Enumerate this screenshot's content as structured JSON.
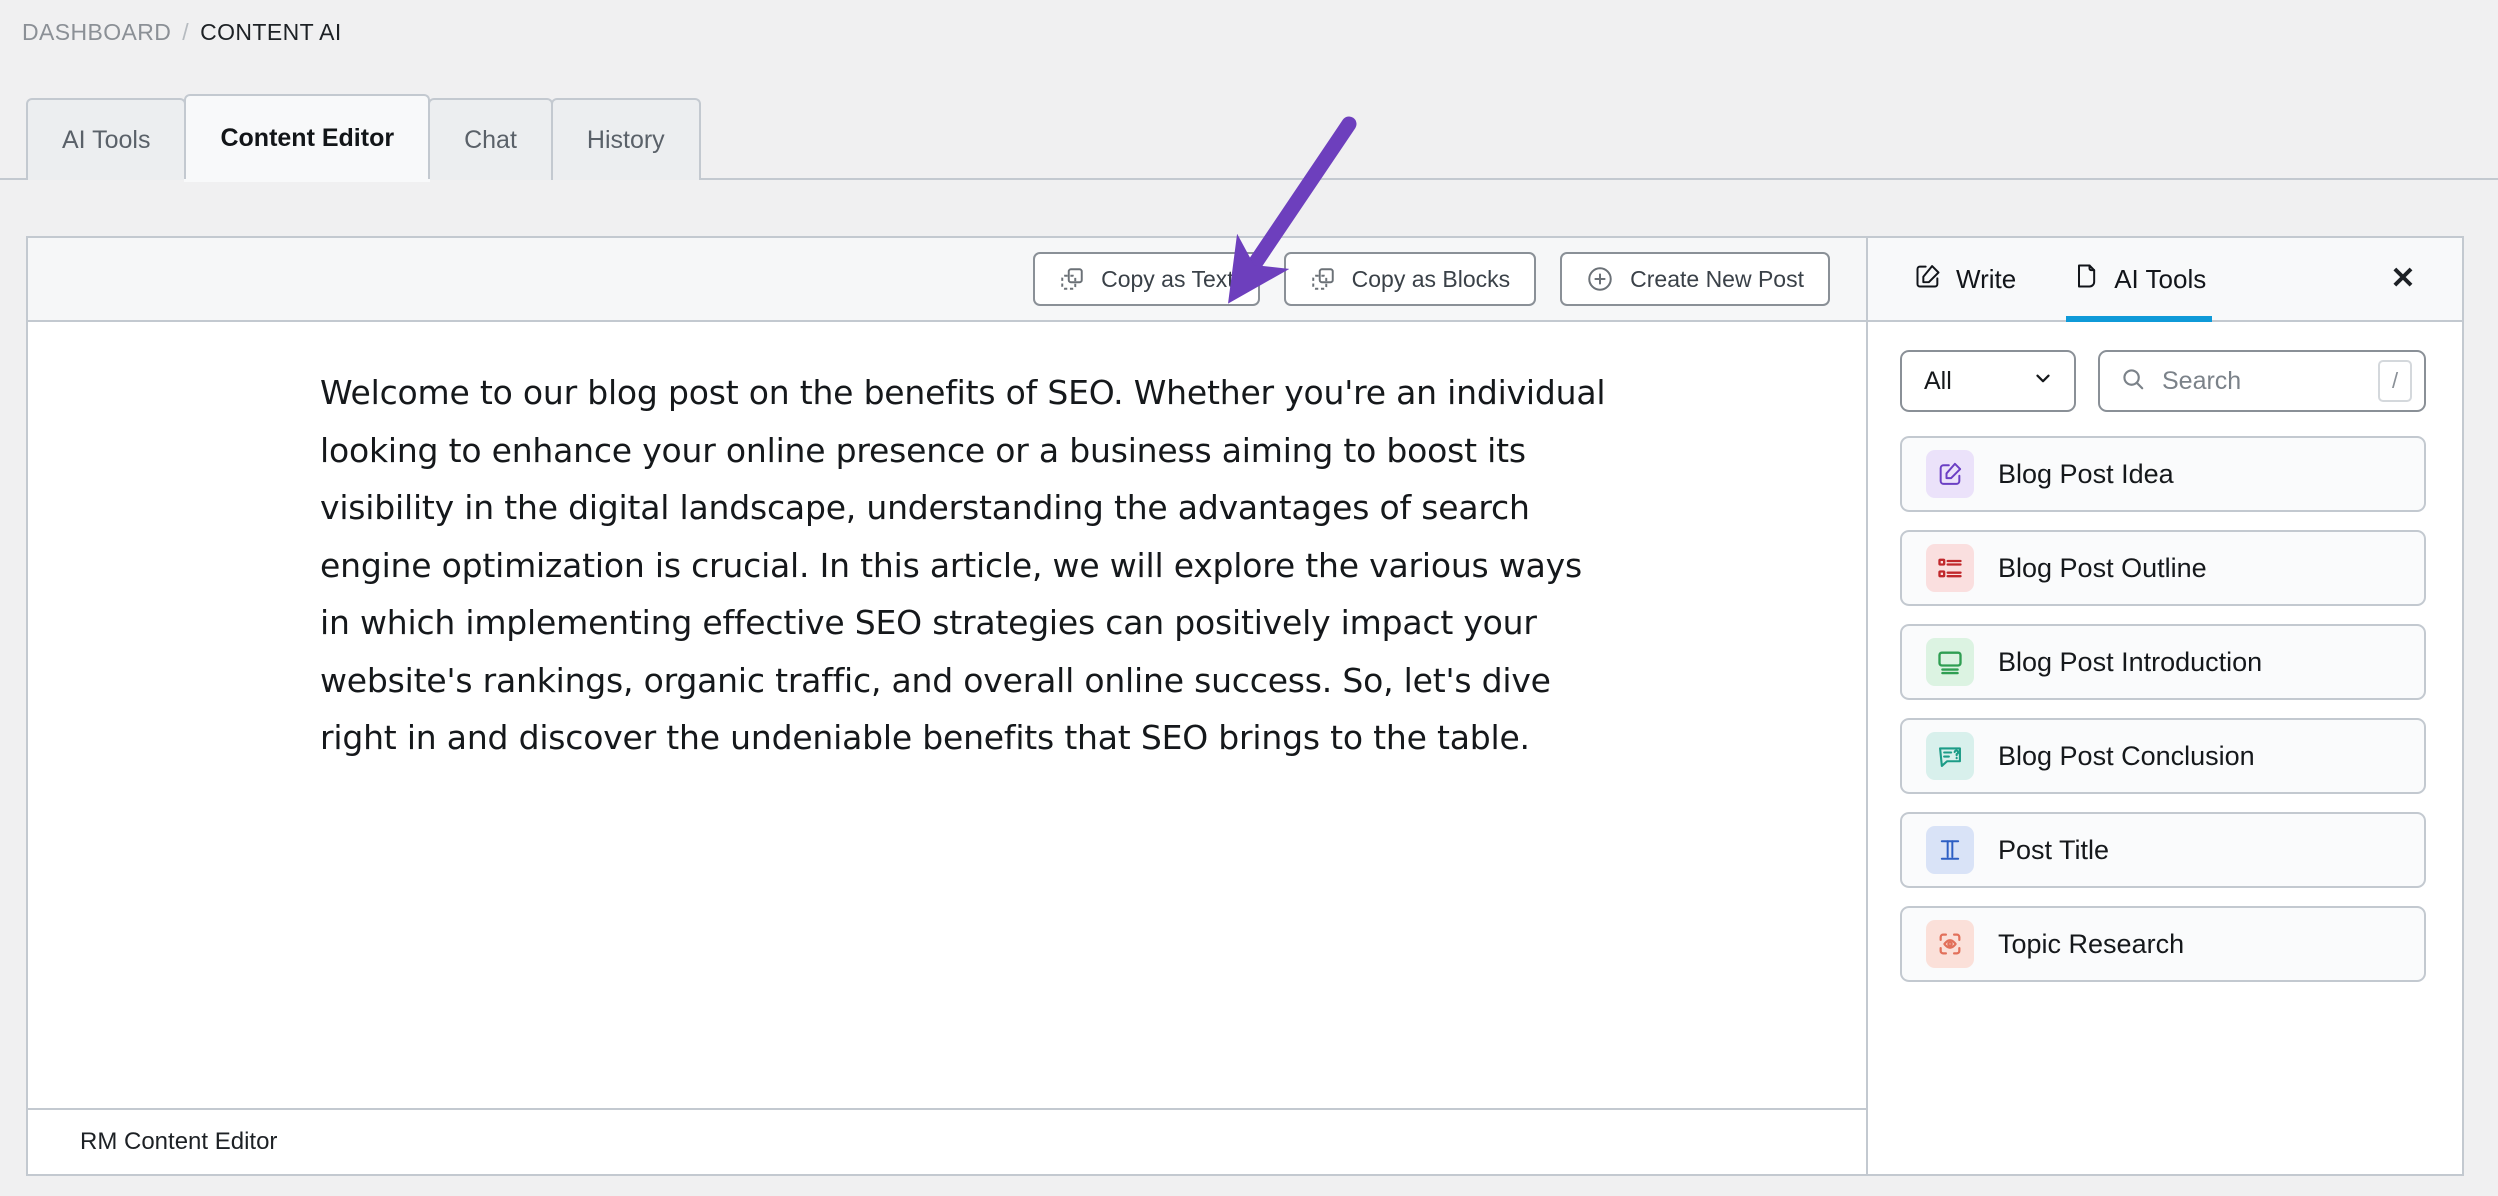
{
  "breadcrumb": {
    "parent": "DASHBOARD",
    "separator": "/",
    "current": "CONTENT AI"
  },
  "tabs": [
    {
      "label": "AI Tools",
      "active": false
    },
    {
      "label": "Content Editor",
      "active": true
    },
    {
      "label": "Chat",
      "active": false
    },
    {
      "label": "History",
      "active": false
    }
  ],
  "editor": {
    "toolbar": {
      "copy_as_text": "Copy as Text",
      "copy_as_blocks": "Copy as Blocks",
      "create_new_post": "Create New Post"
    },
    "content": "Welcome to our blog post on the benefits of SEO. Whether you're an individual looking to enhance your online presence or a business aiming to boost its visibility in the digital landscape, understanding the advantages of search engine optimization is crucial. In this article, we will explore the various ways in which implementing effective SEO strategies can positively impact your website's rankings, organic traffic, and overall online success. So, let's dive right in and discover the undeniable benefits that SEO brings to the table.",
    "add_block_label": "+",
    "footer_label": "RM Content Editor"
  },
  "sidebar": {
    "tabs": [
      {
        "label": "Write",
        "icon": "pencil-square-icon",
        "active": false
      },
      {
        "label": "AI Tools",
        "icon": "document-ai-icon",
        "active": true
      }
    ],
    "close_label": "✕",
    "filter": {
      "selected": "All",
      "chevron": "chevron-down-icon"
    },
    "search": {
      "placeholder": "Search",
      "shortcut": "/"
    },
    "tools": [
      {
        "label": "Blog Post Idea",
        "icon": "pencil-square-icon",
        "fg": "#6b3fc4",
        "bg": "#ebe2fa"
      },
      {
        "label": "Blog Post Outline",
        "icon": "list-checks-icon",
        "fg": "#c0282c",
        "bg": "#fadfdf"
      },
      {
        "label": "Blog Post Introduction",
        "icon": "monitor-text-icon",
        "fg": "#2f9e52",
        "bg": "#dcf3e2"
      },
      {
        "label": "Blog Post Conclusion",
        "icon": "message-question-icon",
        "fg": "#1c9c87",
        "bg": "#d8f0ec"
      },
      {
        "label": "Post Title",
        "icon": "text-title-icon",
        "fg": "#2d5fc4",
        "bg": "#d9e3f7"
      },
      {
        "label": "Topic Research",
        "icon": "scan-eye-icon",
        "fg": "#e2705a",
        "bg": "#fbe0d9"
      }
    ]
  },
  "annotation": {
    "arrow_color": "#6d3fbd",
    "points_to": "Copy as Text"
  },
  "colors": {
    "accent_blue": "#0f9ad8",
    "page_bg": "#f0f0f1",
    "border": "#c3c9d0"
  }
}
